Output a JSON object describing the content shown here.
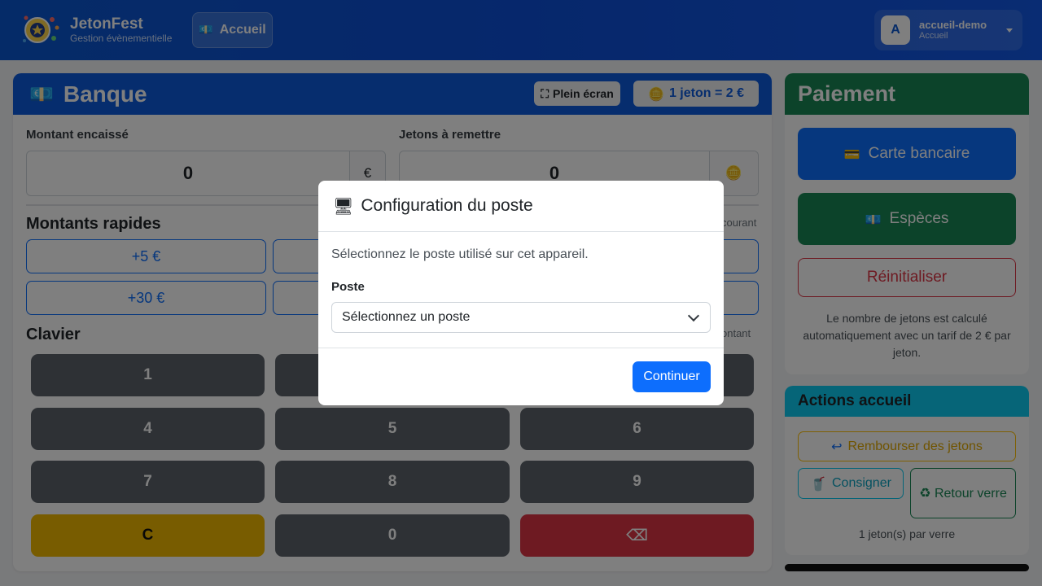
{
  "header": {
    "brand_name": "JetonFest",
    "brand_subtitle": "Gestion évènementielle",
    "nav_label": "Accueil",
    "user_initial": "A",
    "user_name": "accueil-demo",
    "user_role": "Accueil"
  },
  "bank": {
    "title": "Banque",
    "fullscreen_label": "Plein écran",
    "token_rate": "1 jeton = 2 €",
    "amount_label": "Montant encaissé",
    "amount_value": "0",
    "amount_suffix": "€",
    "tokens_label": "Jetons à remettre",
    "tokens_value": "0",
    "quick_title": "Montants rapides",
    "quick_aside": "courant",
    "quick_amounts": [
      "+5 €",
      "+30 €"
    ],
    "keypad_title": "Clavier",
    "keypad_aside": "ontant",
    "keys": [
      "1",
      "4",
      "5",
      "6",
      "7",
      "8",
      "9",
      "C",
      "0",
      "⌫"
    ]
  },
  "payment": {
    "title": "Paiement",
    "card_label": "Carte bancaire",
    "cash_label": "Espèces",
    "reset_label": "Réinitialiser",
    "note": "Le nombre de jetons est calculé automatiquement avec un tarif de 2 € par jeton."
  },
  "actions": {
    "title": "Actions accueil",
    "refund_label": "Rembourser des jetons",
    "consign_label": "Consigner",
    "return_label": "Retour verre",
    "note": "1 jeton(s) par verre"
  },
  "modal": {
    "title": "Configuration du poste",
    "description": "Sélectionnez le poste utilisé sur cet appareil.",
    "field_label": "Poste",
    "select_value": "Sélectionnez un poste",
    "continue_label": "Continuer"
  },
  "colors": {
    "header_blue": "#0b57d0",
    "bank_blue": "#0d5bdc",
    "payment_green": "#198754",
    "actions_cyan": "#0dcaf0",
    "primary": "#0d6efd",
    "danger": "#dc3545",
    "warning": "#f0b800"
  }
}
